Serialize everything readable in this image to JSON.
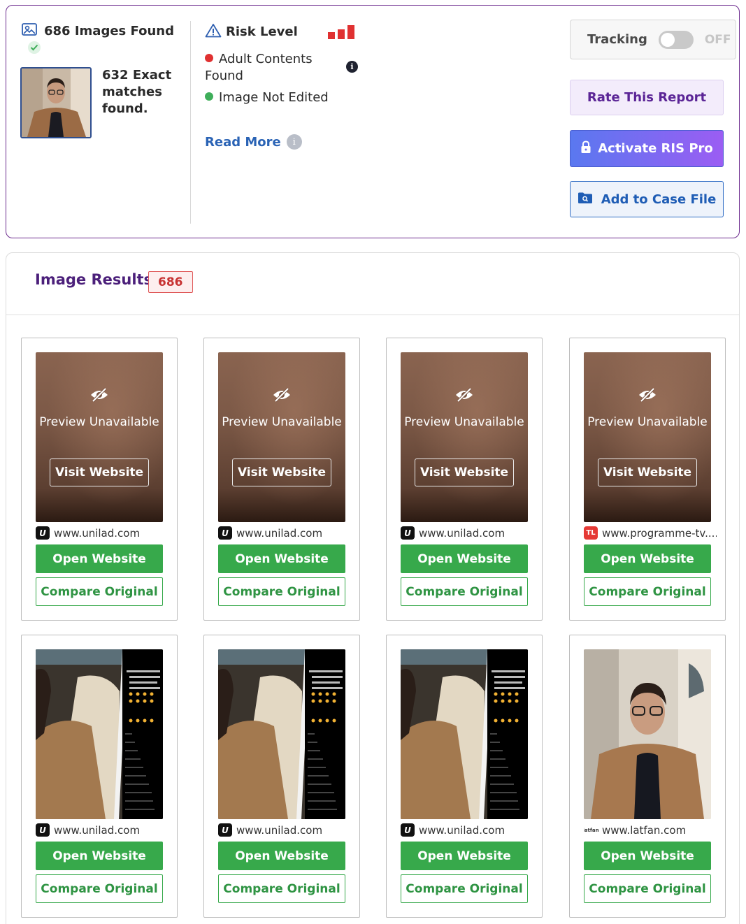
{
  "summary": {
    "images_found": "686 Images Found",
    "exact_matches": "632 Exact matches found.",
    "risk_label": "Risk Level",
    "risk_level": 3,
    "risk_color": "#e03131",
    "adult_contents": "Adult Contents Found",
    "image_not_edited": "Image Not Edited",
    "read_more": "Read More",
    "info_glyph": "i"
  },
  "actions": {
    "tracking_label": "Tracking",
    "tracking_state": "OFF",
    "rate_label": "Rate This Report",
    "activate_label": "Activate RIS Pro",
    "case_label": "Add to Case File"
  },
  "results": {
    "title": "Image Results",
    "count": "686",
    "preview_unavailable": "Preview Unavailable",
    "visit_label": "Visit Website",
    "open_label": "Open Website",
    "compare_label": "Compare Original",
    "cards": [
      {
        "domain": "www.unilad.com",
        "favicon": "U",
        "preview": "blurred"
      },
      {
        "domain": "www.unilad.com",
        "favicon": "U",
        "preview": "blurred"
      },
      {
        "domain": "www.unilad.com",
        "favicon": "U",
        "preview": "blurred"
      },
      {
        "domain": "www.programme-tv....",
        "favicon": "TL",
        "preview": "blurred"
      },
      {
        "domain": "www.unilad.com",
        "favicon": "U",
        "preview": "split-screen"
      },
      {
        "domain": "www.unilad.com",
        "favicon": "U",
        "preview": "split-screen"
      },
      {
        "domain": "www.unilad.com",
        "favicon": "U",
        "preview": "split-screen"
      },
      {
        "domain": "www.latfan.com",
        "favicon": "latfan",
        "preview": "portrait"
      }
    ]
  },
  "colors": {
    "brand_purple": "#4b1f7a",
    "green": "#37a94b",
    "link_blue": "#2a63b5"
  }
}
